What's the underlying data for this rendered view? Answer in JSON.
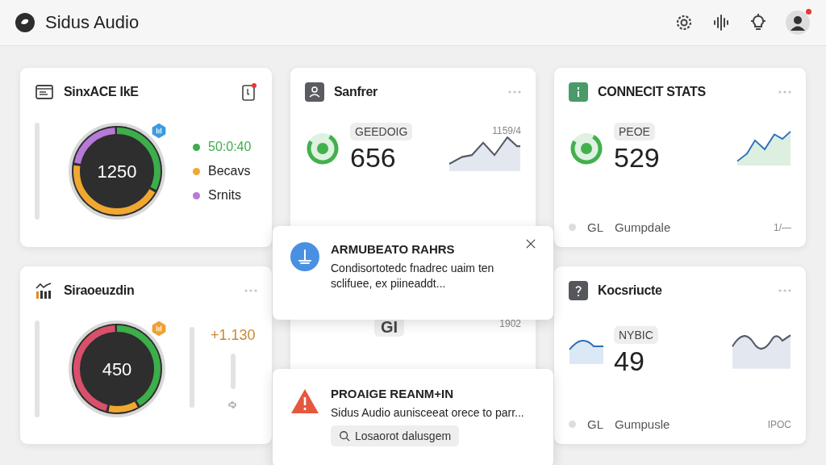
{
  "app": {
    "title": "Sidus Audio",
    "notification": true
  },
  "cards": [
    {
      "kind": "gauge",
      "title": "SinxACE IkE",
      "value": "1250",
      "legend": [
        {
          "label": "50:0:40",
          "color": "#3cae4a"
        },
        {
          "label": "Becavs",
          "color": "#f0a830"
        },
        {
          "label": "Srnits",
          "color": "#b77ad8"
        }
      ]
    },
    {
      "kind": "stat",
      "title": "Sanfrer",
      "tag": "GEEDOIG",
      "value": "656",
      "reading": "1159/4"
    },
    {
      "kind": "stat",
      "title": "CONNECIT STATS",
      "tag": "PEOE",
      "value": "529",
      "footer": {
        "code": "GL",
        "name": "Gumpdale",
        "reading": "1/—"
      }
    },
    {
      "kind": "gauge",
      "title": "Siraoeuzdin",
      "value": "450",
      "delta": "+1.130"
    },
    {
      "kind": "partial",
      "tag": "GI",
      "reading": "1902"
    },
    {
      "kind": "stat",
      "title": "Kocsriucte",
      "tag": "NYBIC",
      "value": "49",
      "footer": {
        "code": "GL",
        "name": "Gumpusle",
        "reading": "IPOC"
      }
    }
  ],
  "toasts": [
    {
      "kind": "info",
      "title": "ARMUBEATO RAHRS",
      "message": "Condisortotedc fnadrec uaim ten sclifuee, ex piineaddt..."
    },
    {
      "kind": "warning",
      "title": "PROAIGE REANM+IN",
      "message": "Sidus Audio aunisceeat orece to parr...",
      "action": "Losaorot dalusgem"
    }
  ]
}
